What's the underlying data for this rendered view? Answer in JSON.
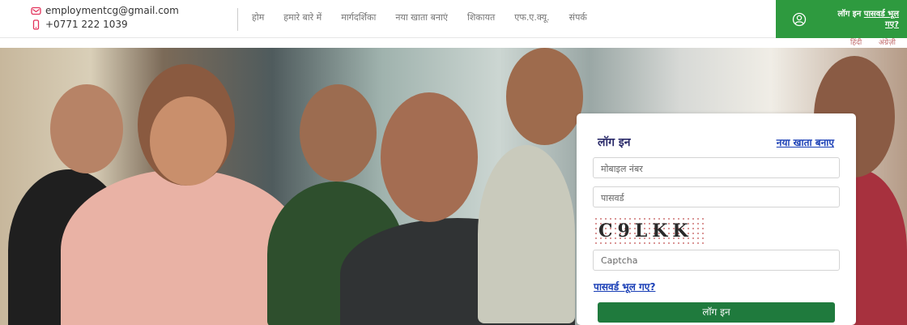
{
  "contact": {
    "email": "employmentcg@gmail.com",
    "phone": "+0771 222 1039",
    "email_icon": "mail-icon",
    "phone_icon": "phone-icon"
  },
  "nav": {
    "items": [
      "होम",
      "हमारे बारे में",
      "मार्गदर्शिका",
      "नया खाता बनाएं",
      "शिकायत",
      "एफ.ए.क्यू.",
      "संपर्क"
    ]
  },
  "top_login": {
    "user_icon": "user-icon",
    "login_label": "लॉग इन",
    "forgot_label": "पासवर्ड भूल गए?"
  },
  "language": {
    "hindi": "हिंदी",
    "english": "अंग्रेज़ी"
  },
  "login_form": {
    "title": "लॉग इन",
    "create_account": "नया खाता बनाए",
    "mobile_placeholder": "मोबाइल नंबर",
    "password_placeholder": "पासवर्ड",
    "captcha_text": "C9LKK",
    "captcha_placeholder": "Captcha",
    "forgot_password": "पासवर्ड भूल गए?",
    "submit_label": "लॉग इन"
  },
  "colors": {
    "accent_green": "#2e9a3f",
    "button_green": "#1f7a3d",
    "link_blue": "#1a3fb6",
    "icon_red": "#e2315a"
  }
}
